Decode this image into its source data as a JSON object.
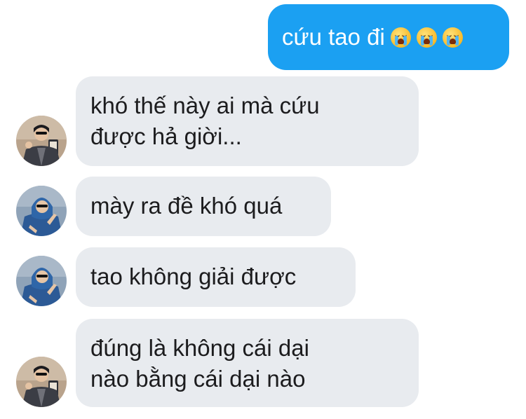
{
  "messages": {
    "outgoing": {
      "text": "cứu tao đi",
      "emojis": [
        "loudly-crying-face-icon",
        "loudly-crying-face-icon",
        "loudly-crying-face-icon"
      ]
    },
    "incoming": [
      {
        "lines": [
          "khó thế này ai mà cứu",
          "được hả giời..."
        ],
        "avatar": "avatar-person-1"
      },
      {
        "lines": [
          "mày ra đề khó quá"
        ],
        "avatar": "avatar-person-2"
      },
      {
        "lines": [
          "tao không giải được"
        ],
        "avatar": "avatar-person-2"
      },
      {
        "lines": [
          "đúng là không cái dại",
          "nào bằng cái dại nào"
        ],
        "avatar": "avatar-person-1"
      }
    ]
  },
  "colors": {
    "outgoing_bubble": "#1ba0f2",
    "incoming_bubble": "#e8ebef",
    "incoming_text": "#1c1c1e",
    "background": "#ffffff"
  }
}
